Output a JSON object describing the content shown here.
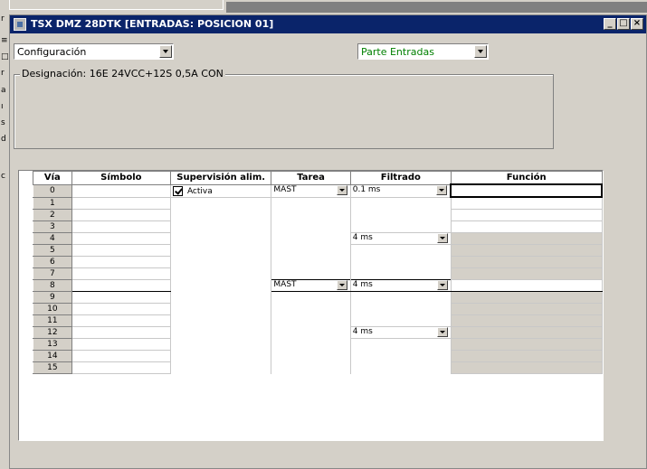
{
  "window": {
    "title": "TSX DMZ 28DTK [ENTRADAS: POSICION 01]",
    "buttons": {
      "minimize": "_",
      "maximize": "□",
      "close": "×"
    }
  },
  "toolbar": {
    "config_value": "Configuración",
    "parte_value": "Parte Entradas",
    "parte_color": "#008000"
  },
  "designation": {
    "label": "Designación: 16E 24VCC+12S 0,5A CON"
  },
  "grid": {
    "headers": {
      "via": "Vía",
      "simbolo": "Símbolo",
      "supervision": "Supervisión alim.",
      "tarea": "Tarea",
      "filtrado": "Filtrado",
      "funcion": "Función"
    },
    "rows": [
      "0",
      "1",
      "2",
      "3",
      "4",
      "5",
      "6",
      "7",
      "8",
      "9",
      "10",
      "11",
      "12",
      "13",
      "14",
      "15"
    ],
    "supervision_value": "Activa",
    "tarea_values": [
      "MAST",
      "MAST"
    ],
    "filtrado_values": [
      "0.1 ms",
      "4 ms",
      "4 ms",
      "4 ms"
    ]
  }
}
